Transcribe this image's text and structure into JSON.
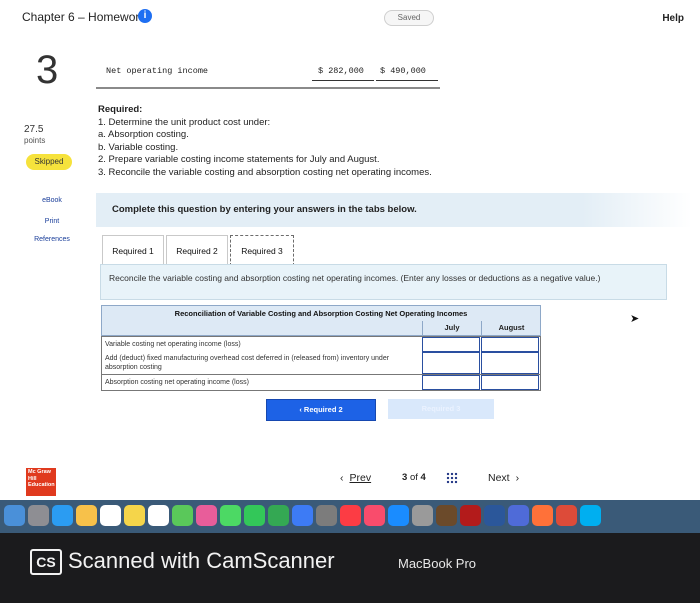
{
  "header": {
    "title": "Chapter 6 – Homework",
    "info_icon": "i",
    "saved": "Saved",
    "help": "Help"
  },
  "question": {
    "number": "3",
    "points_value": "27.5",
    "points_label": "points",
    "status": "Skipped"
  },
  "resources": {
    "ebook": "eBook",
    "print": "Print",
    "references": "References"
  },
  "net_operating_income": {
    "label": "Net operating income",
    "july": "$ 282,000",
    "august": "$   490,000"
  },
  "requirements": {
    "heading": "Required:",
    "items": [
      "1. Determine the unit product cost under:",
      "a. Absorption costing.",
      "b. Variable costing.",
      "2. Prepare variable costing income statements for July and August.",
      "3. Reconcile the variable costing and absorption costing net operating incomes."
    ]
  },
  "banner": "Complete this question by entering your answers in the tabs below.",
  "tabs": [
    {
      "label": "Required 1"
    },
    {
      "label": "Required 2"
    },
    {
      "label": "Required 3"
    }
  ],
  "panel": {
    "instruction": "Reconcile the variable costing and absorption costing net operating incomes. (Enter any losses or deductions as a negative value.)",
    "table": {
      "caption": "Reconciliation of Variable Costing and Absorption Costing Net Operating Incomes",
      "columns": [
        "July",
        "August"
      ],
      "rows": [
        {
          "label": "Variable costing net operating income (loss)",
          "july": "",
          "august": ""
        },
        {
          "label": "Add (deduct) fixed manufacturing overhead cost deferred in (released from) inventory under absorption costing",
          "july": "",
          "august": ""
        },
        {
          "label": "Absorption costing net operating income (loss)",
          "july": "",
          "august": ""
        }
      ]
    },
    "prev_button": "Required 2",
    "next_button": "Required 3"
  },
  "footer": {
    "logo_text": "Mc Graw Hill Education",
    "prev": "Prev",
    "page_current": "3",
    "page_of": "of",
    "page_total": "4",
    "next": "Next"
  },
  "dock_icons": [
    "finder",
    "launchpad",
    "safari",
    "photos",
    "calendar",
    "notes",
    "reminders",
    "maps",
    "photos-app",
    "messages",
    "facetime",
    "numbers",
    "keynote",
    "instruments",
    "itunes",
    "music",
    "app-store",
    "system-preferences",
    "chess",
    "dictionary",
    "word",
    "utility",
    "firefox",
    "chrome",
    "skype"
  ],
  "scanner": {
    "badge": "CS",
    "text": "Scanned with CamScanner",
    "device": "MacBook Pro"
  },
  "colors": {
    "accent": "#1d62e6",
    "skipped": "#f6e23c",
    "banner_bg": "#e3eef6",
    "dock": "#3a5a78"
  }
}
